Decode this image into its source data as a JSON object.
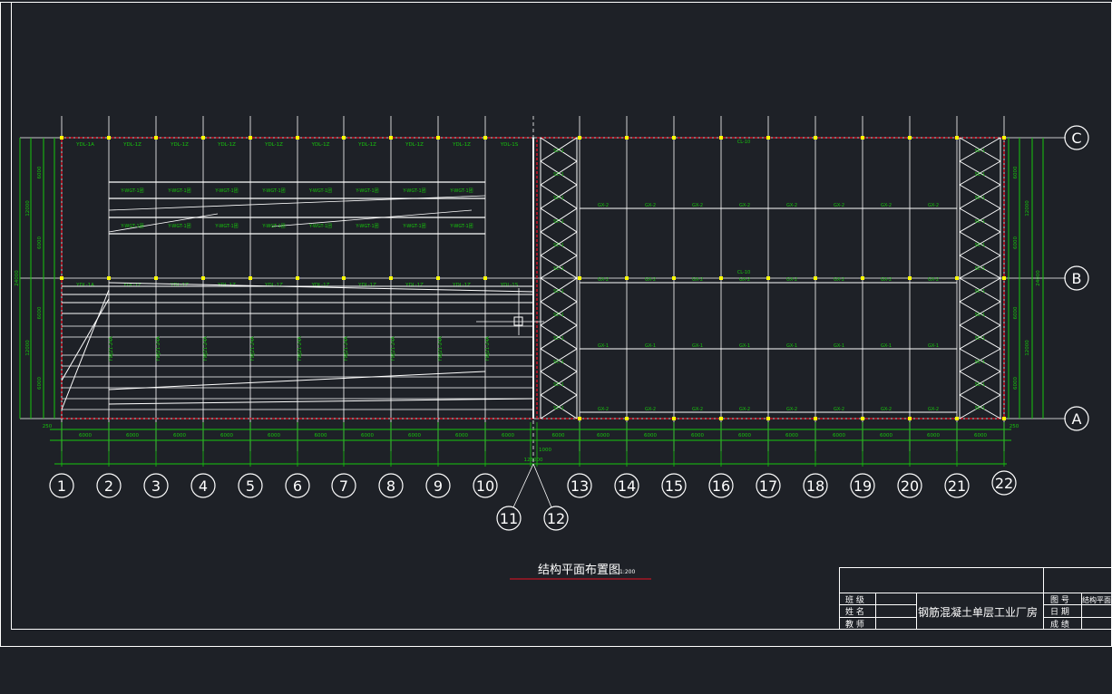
{
  "drawing": {
    "title": "结构平面布置图",
    "scale": "1:200",
    "colors": {
      "background": "#1e2127",
      "line": "#ffffff",
      "dimension": "#16c60c",
      "boundary": "#e81123",
      "axis_marker": "#ffff00"
    }
  },
  "axes": {
    "vertical": [
      "1",
      "2",
      "3",
      "4",
      "5",
      "6",
      "7",
      "8",
      "9",
      "10",
      "11",
      "12",
      "13",
      "14",
      "15",
      "16",
      "17",
      "18",
      "19",
      "20",
      "21",
      "22"
    ],
    "horizontal": [
      "C",
      "B",
      "A"
    ]
  },
  "dimensions": {
    "bay": "6000",
    "row_spans": [
      "6000",
      "6000",
      "6000",
      "6000"
    ],
    "half_spans": [
      "12000",
      "12000"
    ],
    "total_width": "24000",
    "total_length": "126000",
    "edge": "250",
    "expansion": "1000"
  },
  "member_labels": {
    "upper_beam_first": "YDL-1A",
    "upper_beam": "YDL-1Z",
    "upper_beam_last": "YDL-1S",
    "truss": "Y-WGT-1团",
    "roof_girder": "YWJ21-24A",
    "right_purlin": "GX-2",
    "right_purlin_1": "GX-1",
    "right_top": "CL-10",
    "bracing": "SC-1"
  },
  "title_block": {
    "class_label": "班 级",
    "name_label": "姓 名",
    "teacher_label": "教 师",
    "project_name": "钢筋混凝土单层工业厂房",
    "drawing_no_label": "图 号",
    "drawing_no_value": "结构平面",
    "date_label": "日 期",
    "grade_label": "成 绩"
  }
}
